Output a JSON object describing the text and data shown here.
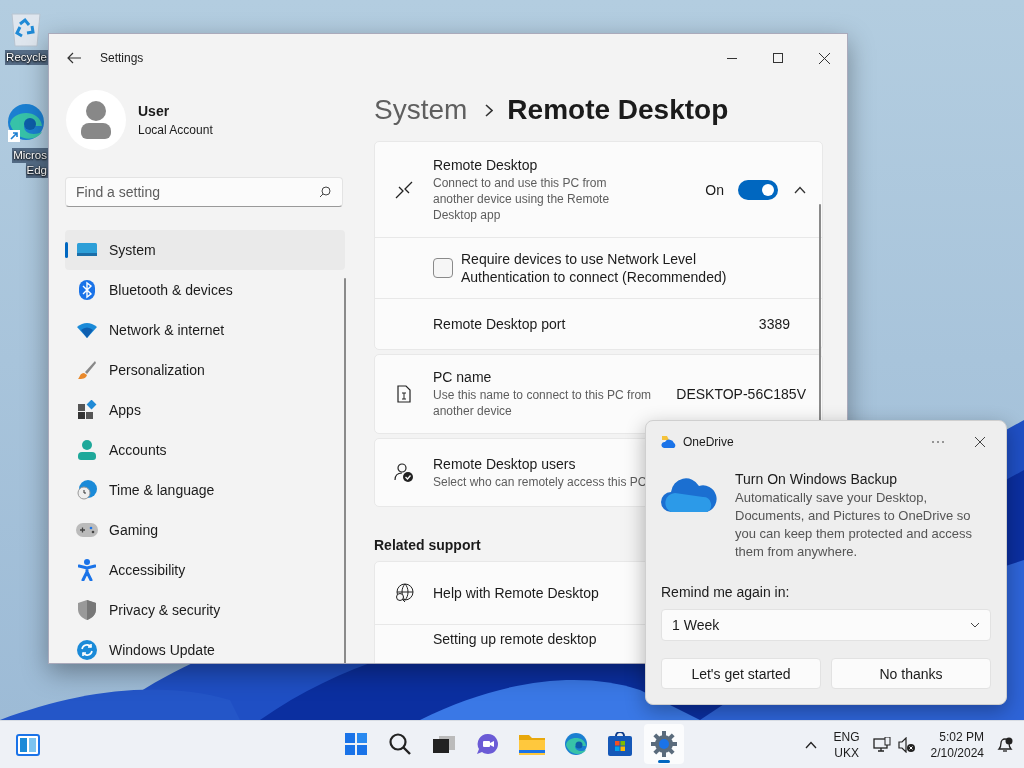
{
  "desktop_icons": [
    {
      "kind": "recycle",
      "lines": [
        "Recycle"
      ]
    },
    {
      "kind": "edge",
      "lines": [
        "Micros",
        "Edg"
      ]
    }
  ],
  "window": {
    "title": "Settings"
  },
  "account": {
    "name": "User",
    "type": "Local Account"
  },
  "search": {
    "placeholder": "Find a setting"
  },
  "sidebar": {
    "items": [
      {
        "label": "System",
        "selected": true
      },
      {
        "label": "Bluetooth & devices",
        "selected": false
      },
      {
        "label": "Network & internet",
        "selected": false
      },
      {
        "label": "Personalization",
        "selected": false
      },
      {
        "label": "Apps",
        "selected": false
      },
      {
        "label": "Accounts",
        "selected": false
      },
      {
        "label": "Time & language",
        "selected": false
      },
      {
        "label": "Gaming",
        "selected": false
      },
      {
        "label": "Accessibility",
        "selected": false
      },
      {
        "label": "Privacy & security",
        "selected": false
      },
      {
        "label": "Windows Update",
        "selected": false
      }
    ]
  },
  "breadcrumb": {
    "parent": "System",
    "current": "Remote Desktop"
  },
  "remote_desktop": {
    "title": "Remote Desktop",
    "description": "Connect to and use this PC from another device using the Remote Desktop app",
    "state_label": "On",
    "on": true,
    "expanded": true
  },
  "nla": {
    "label": "Require devices to use Network Level Authentication to connect (Recommended)",
    "checked": false
  },
  "port": {
    "label": "Remote Desktop port",
    "value": "3389"
  },
  "pc_name": {
    "title": "PC name",
    "description": "Use this name to connect to this PC from another device",
    "value": "DESKTOP-56C185V"
  },
  "users": {
    "title": "Remote Desktop users",
    "description": "Select who can remotely access this PC"
  },
  "related_support": {
    "heading": "Related support",
    "items": [
      {
        "label": "Help with Remote Desktop"
      },
      {
        "label": "Setting up remote desktop"
      }
    ]
  },
  "onedrive": {
    "app": "OneDrive",
    "title": "Turn On Windows Backup",
    "body": "Automatically save your Desktop, Documents, and Pictures to OneDrive so you can keep them protected and access them from anywhere.",
    "remind_label": "Remind me again in:",
    "remind_value": "1 Week",
    "buttons": [
      "Let's get started",
      "No thanks"
    ]
  },
  "taskbar": {
    "apps": [
      {
        "kind": "start",
        "running": false
      },
      {
        "kind": "search",
        "running": false
      },
      {
        "kind": "taskview",
        "running": false
      },
      {
        "kind": "chat",
        "running": false
      },
      {
        "kind": "files",
        "running": false
      },
      {
        "kind": "edge",
        "running": false
      },
      {
        "kind": "store",
        "running": false
      },
      {
        "kind": "settings",
        "running": true
      }
    ],
    "language": [
      "ENG",
      "UKX"
    ],
    "time": "5:02 PM",
    "date": "2/10/2024"
  }
}
